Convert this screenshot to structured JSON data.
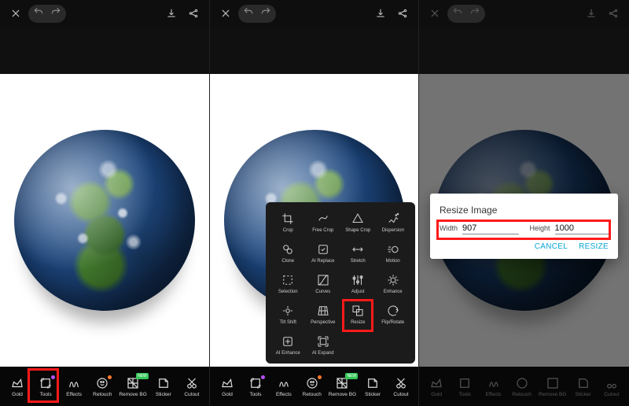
{
  "bottombar": {
    "items": [
      {
        "label": "Gold"
      },
      {
        "label": "Tools"
      },
      {
        "label": "Effects"
      },
      {
        "label": "Retouch"
      },
      {
        "label": "Remove BG"
      },
      {
        "label": "Sticker"
      },
      {
        "label": "Cutout"
      }
    ]
  },
  "tools": {
    "cells": [
      "Crop",
      "Free Crop",
      "Shape Crop",
      "Dispersion",
      "Clone",
      "AI Replace",
      "Stretch",
      "Motion",
      "Selection",
      "Curves",
      "Adjust",
      "Enhance",
      "Tilt Shift",
      "Perspective",
      "Resize",
      "Flip/Rotate",
      "AI Enhance",
      "AI Expand"
    ]
  },
  "dialog": {
    "title": "Resize Image",
    "width_label": "Width",
    "width_value": "907",
    "height_label": "Height",
    "height_value": "1000",
    "cancel": "CANCEL",
    "resize": "RESIZE"
  }
}
